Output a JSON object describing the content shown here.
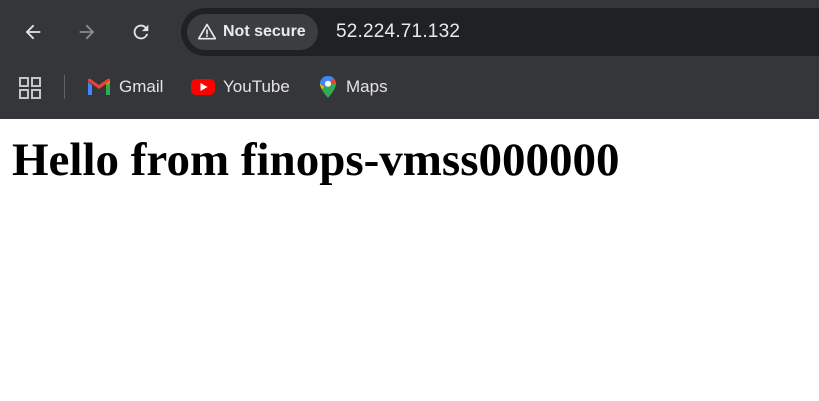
{
  "toolbar": {
    "security_label": "Not secure",
    "url": "52.224.71.132",
    "icons": {
      "back": "back-arrow-icon",
      "forward": "forward-arrow-icon",
      "reload": "reload-icon",
      "security": "warning-triangle-icon"
    }
  },
  "bookmarks": {
    "items": [
      {
        "label": "Gmail",
        "icon": "gmail-icon"
      },
      {
        "label": "YouTube",
        "icon": "youtube-icon"
      },
      {
        "label": "Maps",
        "icon": "maps-icon"
      }
    ]
  },
  "page": {
    "heading": "Hello from finops-vmss000000"
  },
  "colors": {
    "chrome_bg": "#35363a",
    "omnibox_bg": "#202124",
    "chip_bg": "#3c3d41",
    "page_bg": "#ffffff"
  }
}
